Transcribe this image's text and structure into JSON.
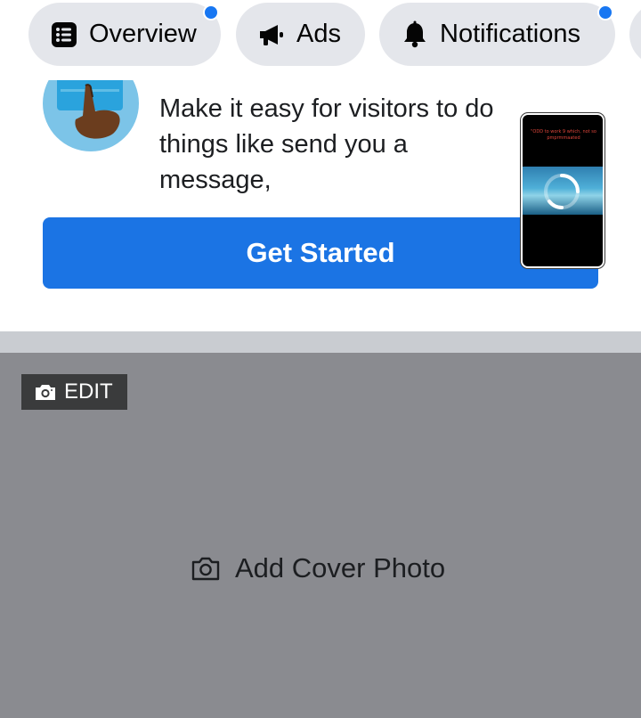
{
  "tabs": [
    {
      "label": "Overview",
      "icon": "list-icon",
      "has_badge": true
    },
    {
      "label": "Ads",
      "icon": "megaphone-icon",
      "has_badge": false
    },
    {
      "label": "Notifications",
      "icon": "bell-icon",
      "has_badge": true
    }
  ],
  "promo": {
    "body": "Make it easy for visitors to do\nthings like send you a message,\nbook an appointment and more.",
    "cta_label": "Get Started"
  },
  "video_overlay": {
    "caption": "\"ODD to work 9 which, not so pmprmmaated"
  },
  "cover": {
    "edit_label": "EDIT",
    "add_cover_label": "Add Cover Photo"
  },
  "colors": {
    "accent": "#1b74e4",
    "badge": "#1877f2",
    "chip_bg": "#e4e6eb",
    "cover_bg": "#8a8b90",
    "edit_bg": "#3a3b3c"
  }
}
